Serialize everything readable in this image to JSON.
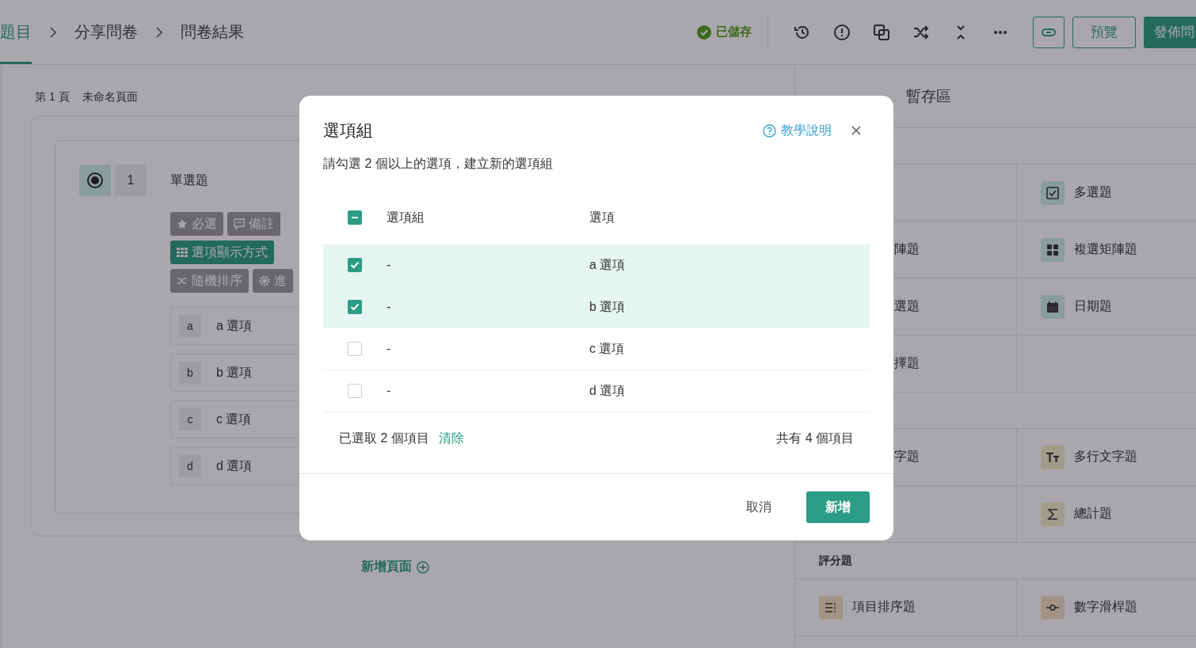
{
  "header": {
    "steps": [
      {
        "label": "題目",
        "selected": true
      },
      {
        "label": "分享問卷",
        "selected": false
      },
      {
        "label": "問卷結果",
        "selected": false
      }
    ],
    "save_status": "已儲存",
    "preview_button": "預覽",
    "publish_button": "發佈問"
  },
  "page": {
    "number_label": "第 1 頁",
    "name": "未命名頁面"
  },
  "question": {
    "number": "1",
    "title": "單選題",
    "tag_rows": [
      [
        {
          "label": "必選",
          "selected": false
        },
        {
          "label": "備註",
          "selected": false
        }
      ],
      [
        {
          "label": "選項顯示方式",
          "selected": true
        }
      ],
      [
        {
          "label": "隨機排序",
          "selected": false
        },
        {
          "label": "進",
          "selected": false
        }
      ]
    ],
    "options": [
      {
        "letter": "a",
        "label": "a 選項"
      },
      {
        "letter": "b",
        "label": "b 選項"
      },
      {
        "letter": "c",
        "label": "c 選項"
      },
      {
        "letter": "d",
        "label": "d 選項"
      }
    ]
  },
  "add_page": "新增頁面",
  "side_panel": {
    "tabs": [
      {
        "label": "暫存區",
        "selected": false
      }
    ],
    "sections": [
      {
        "rows": [
          {
            "right": "多選題"
          },
          {
            "left": "陣題",
            "right": "複選矩陣題"
          },
          {
            "left": "選題",
            "right": "日期題"
          },
          {
            "left": "擇題"
          }
        ]
      },
      {
        "rows": [
          {
            "left": "字題",
            "right": "多行文字題"
          },
          {
            "right": "總計題"
          }
        ]
      },
      {
        "title": "評分題",
        "rows": [
          {
            "left": "項目排序題",
            "right": "數字滑桿題"
          }
        ]
      }
    ]
  },
  "dialog": {
    "title": "選項組",
    "help_link": "教學說明",
    "description": "請勾選 2 個以上的選項，建立新的選項組",
    "header_checkbox": {
      "indeterminate": true
    },
    "columns": [
      "選項組",
      "選項"
    ],
    "rows": [
      {
        "group": "-",
        "option": "a 選項",
        "checked": true
      },
      {
        "group": "-",
        "option": "b 選項",
        "checked": true
      },
      {
        "group": "-",
        "option": "c 選項",
        "checked": false
      },
      {
        "group": "-",
        "option": "d 選項",
        "checked": false
      }
    ],
    "selected_count": "已選取 2 個項目",
    "clear_link": "清除",
    "total_count": "共有 4 個項目",
    "cancel_button": "取消",
    "confirm_button": "新增"
  }
}
